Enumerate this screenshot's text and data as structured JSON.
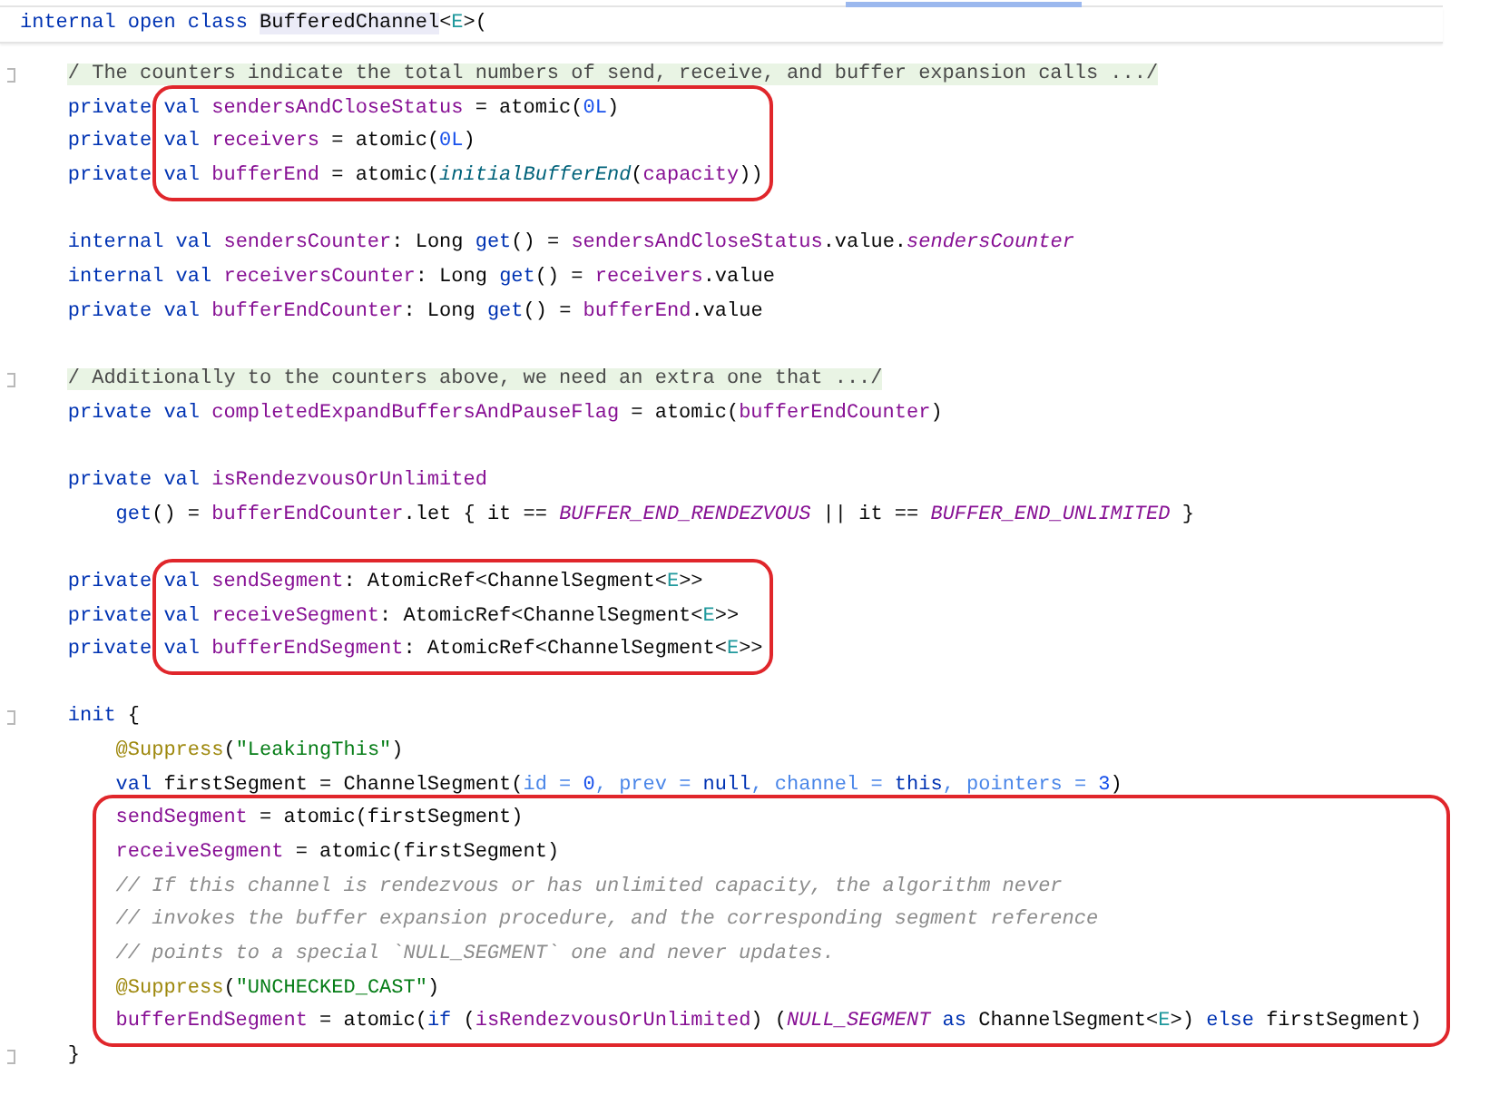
{
  "header": {
    "tokens": [
      {
        "kind": "kw",
        "text": "internal open class "
      },
      {
        "kind": "cls-hl",
        "text": "BufferedChannel"
      },
      {
        "kind": "plain",
        "text": "<"
      },
      {
        "kind": "tp",
        "text": "E"
      },
      {
        "kind": "plain",
        "text": ">("
      }
    ]
  },
  "body": [
    {
      "kind": "line",
      "fold": true,
      "tokens": [
        {
          "kind": "fold-cmt",
          "text": "/ The counters indicate the total numbers of send, receive, and buffer expansion calls .../"
        }
      ]
    },
    {
      "kind": "outlined",
      "lines": [
        {
          "lead": [
            {
              "kind": "kw",
              "text": "private"
            }
          ],
          "tokens": [
            {
              "kind": "kw",
              "text": "val "
            },
            {
              "kind": "prop",
              "text": "sendersAndCloseStatus"
            },
            {
              "kind": "plain",
              "text": " = atomic("
            },
            {
              "kind": "num",
              "text": "0L"
            },
            {
              "kind": "plain",
              "text": ")"
            }
          ]
        },
        {
          "lead": [
            {
              "kind": "kw",
              "text": "private"
            }
          ],
          "tokens": [
            {
              "kind": "kw",
              "text": "val "
            },
            {
              "kind": "prop",
              "text": "receivers"
            },
            {
              "kind": "plain",
              "text": " = atomic("
            },
            {
              "kind": "num",
              "text": "0L"
            },
            {
              "kind": "plain",
              "text": ")"
            }
          ]
        },
        {
          "lead": [
            {
              "kind": "kw",
              "text": "private"
            }
          ],
          "tokens": [
            {
              "kind": "kw",
              "text": "val "
            },
            {
              "kind": "prop",
              "text": "bufferEnd"
            },
            {
              "kind": "plain",
              "text": " = atomic("
            },
            {
              "kind": "fn",
              "text": "initialBufferEnd"
            },
            {
              "kind": "plain",
              "text": "("
            },
            {
              "kind": "prop",
              "text": "capacity"
            },
            {
              "kind": "plain",
              "text": "))"
            }
          ]
        }
      ]
    },
    {
      "kind": "blank"
    },
    {
      "kind": "line",
      "fold": false,
      "tokens": [
        {
          "kind": "kw",
          "text": "internal val "
        },
        {
          "kind": "prop",
          "text": "sendersCounter"
        },
        {
          "kind": "plain",
          "text": ": Long "
        },
        {
          "kind": "kw",
          "text": "get"
        },
        {
          "kind": "plain",
          "text": "() = "
        },
        {
          "kind": "prop",
          "text": "sendersAndCloseStatus"
        },
        {
          "kind": "plain",
          "text": ".value."
        },
        {
          "kind": "static",
          "text": "sendersCounter"
        }
      ]
    },
    {
      "kind": "line",
      "fold": false,
      "tokens": [
        {
          "kind": "kw",
          "text": "internal val "
        },
        {
          "kind": "prop",
          "text": "receiversCounter"
        },
        {
          "kind": "plain",
          "text": ": Long "
        },
        {
          "kind": "kw",
          "text": "get"
        },
        {
          "kind": "plain",
          "text": "() = "
        },
        {
          "kind": "prop",
          "text": "receivers"
        },
        {
          "kind": "plain",
          "text": ".value"
        }
      ]
    },
    {
      "kind": "line",
      "fold": false,
      "tokens": [
        {
          "kind": "kw",
          "text": "private val "
        },
        {
          "kind": "prop",
          "text": "bufferEndCounter"
        },
        {
          "kind": "plain",
          "text": ": Long "
        },
        {
          "kind": "kw",
          "text": "get"
        },
        {
          "kind": "plain",
          "text": "() = "
        },
        {
          "kind": "prop",
          "text": "bufferEnd"
        },
        {
          "kind": "plain",
          "text": ".value"
        }
      ]
    },
    {
      "kind": "blank"
    },
    {
      "kind": "line",
      "fold": true,
      "tokens": [
        {
          "kind": "fold-cmt",
          "text": "/ Additionally to the counters above, we need an extra one that .../"
        }
      ]
    },
    {
      "kind": "line",
      "fold": false,
      "tokens": [
        {
          "kind": "kw",
          "text": "private val "
        },
        {
          "kind": "prop",
          "text": "completedExpandBuffersAndPauseFlag"
        },
        {
          "kind": "plain",
          "text": " = atomic("
        },
        {
          "kind": "prop",
          "text": "bufferEndCounter"
        },
        {
          "kind": "plain",
          "text": ")"
        }
      ]
    },
    {
      "kind": "blank"
    },
    {
      "kind": "line",
      "fold": false,
      "tokens": [
        {
          "kind": "kw",
          "text": "private val "
        },
        {
          "kind": "prop",
          "text": "isRendezvousOrUnlimited"
        }
      ],
      "children": [
        {
          "kind": "line",
          "fold": false,
          "tokens": [
            {
              "kind": "kw",
              "text": "get"
            },
            {
              "kind": "plain",
              "text": "() = "
            },
            {
              "kind": "prop",
              "text": "bufferEndCounter"
            },
            {
              "kind": "plain",
              "text": ".let { it == "
            },
            {
              "kind": "static",
              "text": "BUFFER_END_RENDEZVOUS"
            },
            {
              "kind": "plain",
              "text": " || it == "
            },
            {
              "kind": "static",
              "text": "BUFFER_END_UNLIMITED"
            },
            {
              "kind": "plain",
              "text": " }"
            }
          ]
        }
      ]
    },
    {
      "kind": "blank"
    },
    {
      "kind": "outlined",
      "lines": [
        {
          "lead": [
            {
              "kind": "kw",
              "text": "private"
            }
          ],
          "tokens": [
            {
              "kind": "kw",
              "text": "val "
            },
            {
              "kind": "prop",
              "text": "sendSegment"
            },
            {
              "kind": "plain",
              "text": ": AtomicRef<ChannelSegment<"
            },
            {
              "kind": "tp",
              "text": "E"
            },
            {
              "kind": "plain",
              "text": ">>"
            }
          ]
        },
        {
          "lead": [
            {
              "kind": "kw",
              "text": "private"
            }
          ],
          "tokens": [
            {
              "kind": "kw",
              "text": "val "
            },
            {
              "kind": "prop",
              "text": "receiveSegment"
            },
            {
              "kind": "plain",
              "text": ": AtomicRef<ChannelSegment<"
            },
            {
              "kind": "tp",
              "text": "E"
            },
            {
              "kind": "plain",
              "text": ">>"
            }
          ]
        },
        {
          "lead": [
            {
              "kind": "kw",
              "text": "private"
            }
          ],
          "tokens": [
            {
              "kind": "kw",
              "text": "val "
            },
            {
              "kind": "prop",
              "text": "bufferEndSegment"
            },
            {
              "kind": "plain",
              "text": ": AtomicRef<ChannelSegment<"
            },
            {
              "kind": "tp",
              "text": "E"
            },
            {
              "kind": "plain",
              "text": ">>"
            }
          ]
        }
      ]
    },
    {
      "kind": "blank"
    },
    {
      "kind": "line",
      "fold": true,
      "tokens": [
        {
          "kind": "kw",
          "text": "init"
        },
        {
          "kind": "plain",
          "text": " {"
        }
      ],
      "children": [
        {
          "kind": "line",
          "fold": false,
          "tokens": [
            {
              "kind": "ann",
              "text": "@Suppress"
            },
            {
              "kind": "plain",
              "text": "("
            },
            {
              "kind": "str",
              "text": "\"LeakingThis\""
            },
            {
              "kind": "plain",
              "text": ")"
            }
          ]
        },
        {
          "kind": "line",
          "fold": false,
          "tokens": [
            {
              "kind": "kw",
              "text": "val "
            },
            {
              "kind": "plain",
              "text": "firstSegment = ChannelSegment("
            },
            {
              "kind": "param",
              "text": "id = "
            },
            {
              "kind": "num",
              "text": "0"
            },
            {
              "kind": "param",
              "text": ", prev = "
            },
            {
              "kind": "kw",
              "text": "null"
            },
            {
              "kind": "param",
              "text": ", channel = "
            },
            {
              "kind": "kw",
              "text": "this"
            },
            {
              "kind": "param",
              "text": ", pointers = "
            },
            {
              "kind": "num",
              "text": "3"
            },
            {
              "kind": "plain",
              "text": ")"
            }
          ]
        },
        {
          "kind": "outlined",
          "lines": [
            {
              "tokens": [
                {
                  "kind": "prop",
                  "text": "sendSegment"
                },
                {
                  "kind": "plain",
                  "text": " = atomic(firstSegment)"
                }
              ]
            },
            {
              "tokens": [
                {
                  "kind": "prop",
                  "text": "receiveSegment"
                },
                {
                  "kind": "plain",
                  "text": " = atomic(firstSegment)"
                }
              ]
            },
            {
              "tokens": [
                {
                  "kind": "cmt",
                  "text": "// If this channel is rendezvous or has unlimited capacity, the algorithm never"
                }
              ]
            },
            {
              "tokens": [
                {
                  "kind": "cmt",
                  "text": "// invokes the buffer expansion procedure, and the corresponding segment reference"
                }
              ]
            },
            {
              "tokens": [
                {
                  "kind": "cmt",
                  "text": "// points to a special `NULL_SEGMENT` one and never updates."
                }
              ]
            },
            {
              "tokens": [
                {
                  "kind": "ann",
                  "text": "@Suppress"
                },
                {
                  "kind": "plain",
                  "text": "("
                },
                {
                  "kind": "str",
                  "text": "\"UNCHECKED_CAST\""
                },
                {
                  "kind": "plain",
                  "text": ")"
                }
              ]
            },
            {
              "tokens": [
                {
                  "kind": "prop",
                  "text": "bufferEndSegment"
                },
                {
                  "kind": "plain",
                  "text": " = atomic("
                },
                {
                  "kind": "kw",
                  "text": "if"
                },
                {
                  "kind": "plain",
                  "text": " ("
                },
                {
                  "kind": "prop",
                  "text": "isRendezvousOrUnlimited"
                },
                {
                  "kind": "plain",
                  "text": ") ("
                },
                {
                  "kind": "static",
                  "text": "NULL_SEGMENT"
                },
                {
                  "kind": "kw",
                  "text": " as "
                },
                {
                  "kind": "plain",
                  "text": "ChannelSegment<"
                },
                {
                  "kind": "tp",
                  "text": "E"
                },
                {
                  "kind": "plain",
                  "text": ">) "
                },
                {
                  "kind": "kw",
                  "text": "else"
                },
                {
                  "kind": "plain",
                  "text": " firstSegment)"
                }
              ]
            }
          ]
        }
      ]
    },
    {
      "kind": "line",
      "fold": true,
      "tokens": [
        {
          "kind": "plain",
          "text": "}"
        }
      ]
    }
  ]
}
